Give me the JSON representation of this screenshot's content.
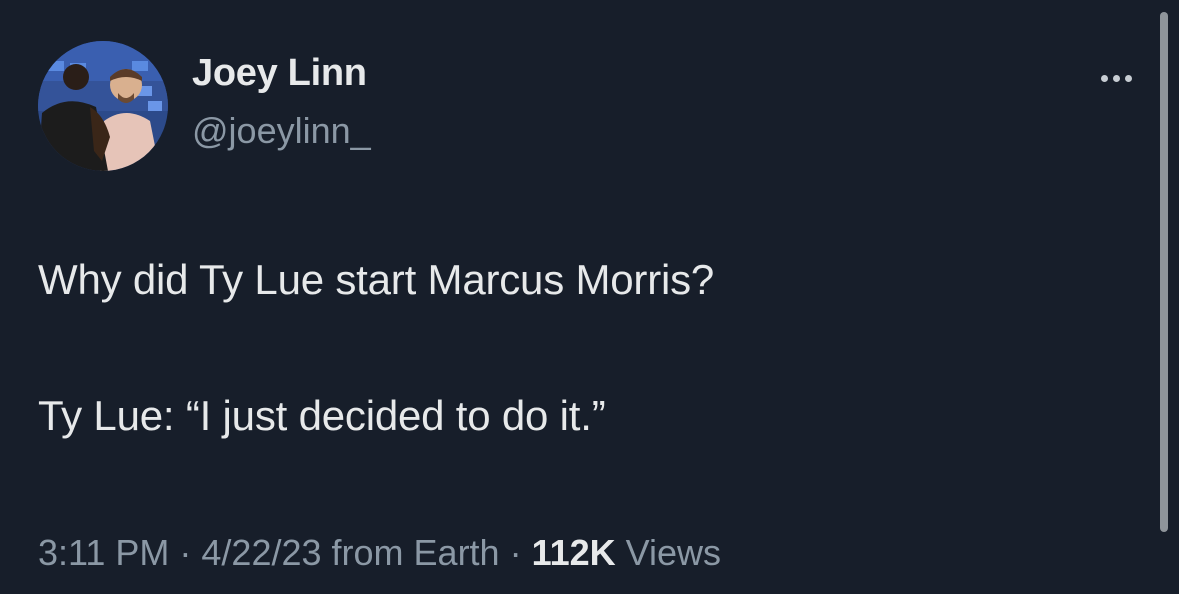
{
  "author": {
    "display_name": "Joey Linn",
    "handle": "@joeylinn_"
  },
  "tweet": {
    "line_1": "Why did Ty Lue start Marcus Morris?",
    "line_2": "Ty Lue: “I just decided to do it.”"
  },
  "meta": {
    "time": "3:11 PM",
    "separator": " · ",
    "date": "4/22/23",
    "source": " from Earth",
    "views_count": "112K",
    "views_label": " Views"
  },
  "icons": {
    "more": "more-horizontal-icon"
  },
  "colors": {
    "background": "#171e2a",
    "primary_text": "#e7e9ea",
    "secondary_text": "#8b98a5"
  }
}
